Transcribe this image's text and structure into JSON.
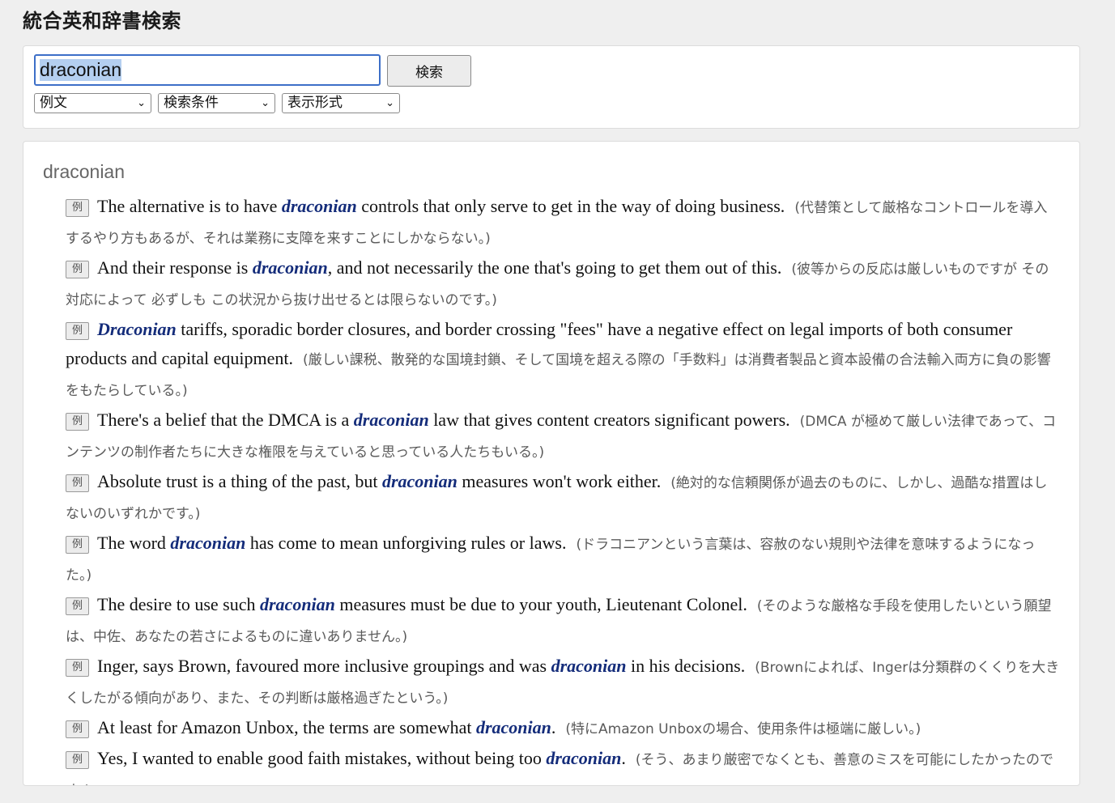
{
  "app": {
    "title": "統合英和辞書検索"
  },
  "search": {
    "query": "draconian",
    "button_label": "検索",
    "filters": [
      {
        "selected": "例文"
      },
      {
        "selected": "検索条件"
      },
      {
        "selected": "表示形式"
      }
    ]
  },
  "results": {
    "headword": "draconian",
    "badge_label": "例",
    "entries": [
      {
        "before": "The alternative is to have ",
        "keyword": "draconian",
        "after": " controls that only serve to get in the way of doing business.",
        "translation": "(代替策として厳格なコントロールを導入するやり方もあるが、それは業務に支障を来すことにしかならない。)"
      },
      {
        "before": "And their response is ",
        "keyword": "draconian",
        "after": ", and not necessarily the one that's going to get them out of this.",
        "translation": "(彼等からの反応は厳しいものですが その対応によって 必ずしも この状況から抜け出せるとは限らないのです。)"
      },
      {
        "before": "",
        "keyword": "Draconian",
        "after": " tariffs, sporadic border closures, and border crossing \"fees\" have a negative effect on legal imports of both consumer products and capital equipment.",
        "translation": "(厳しい課税、散発的な国境封鎖、そして国境を超える際の「手数料」は消費者製品と資本設備の合法輸入両方に負の影響をもたらしている。)"
      },
      {
        "before": "There's a belief that the DMCA is a ",
        "keyword": "draconian",
        "after": " law that gives content creators significant powers.",
        "translation": "(DMCA が極めて厳しい法律であって、コンテンツの制作者たちに大きな権限を与えていると思っている人たちもいる。)"
      },
      {
        "before": "Absolute trust is a thing of the past, but ",
        "keyword": "draconian",
        "after": " measures won't work either.",
        "translation": "(絶対的な信頼関係が過去のものに、しかし、過酷な措置はしないのいずれかです。)"
      },
      {
        "before": "The word ",
        "keyword": "draconian",
        "after": " has come to mean unforgiving rules or laws.",
        "translation": "(ドラコニアンという言葉は、容赦のない規則や法律を意味するようになった。)"
      },
      {
        "before": "The desire to use such ",
        "keyword": "draconian",
        "after": " measures must be due to your youth, Lieutenant Colonel.",
        "translation": "(そのような厳格な手段を使用したいという願望は、中佐、あなたの若さによるものに違いありません。)"
      },
      {
        "before": "Inger, says Brown, favoured more inclusive groupings and was ",
        "keyword": "draconian",
        "after": " in his decisions.",
        "translation": "(Brownによれば、Ingerは分類群のくくりを大きくしたがる傾向があり、また、その判断は厳格過ぎたという。)"
      },
      {
        "before": "At least for Amazon Unbox, the terms are somewhat ",
        "keyword": "draconian",
        "after": ".",
        "translation": "(特にAmazon Unboxの場合、使用条件は極端に厳しい。)"
      },
      {
        "before": "Yes, I wanted to enable good faith mistakes, without being too ",
        "keyword": "draconian",
        "after": ".",
        "translation": "(そう、あまり厳密でなくとも、善意のミスを可能にしたかったのです。)"
      }
    ]
  }
}
